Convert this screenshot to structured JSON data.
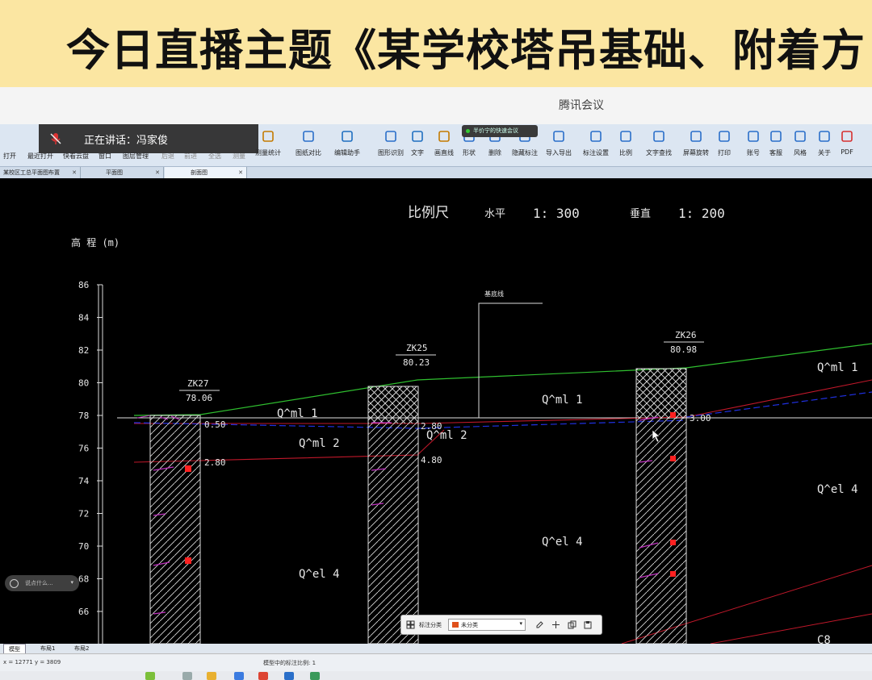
{
  "banner": {
    "title": "今日直播主题《某学校塔吊基础、附着方"
  },
  "meeting": {
    "app_title": "腾讯会议",
    "speaker_label": "正在讲话：冯家俊",
    "share_status": "半价宁的快速会议"
  },
  "toolbar": {
    "buttons": [
      {
        "label": "打开",
        "icon": "open-folder-icon"
      },
      {
        "label": "最近打开",
        "icon": "recent-icon"
      },
      {
        "label": "快看云盘",
        "icon": "cloud-icon"
      },
      {
        "label": "窗口",
        "icon": "window-icon"
      },
      {
        "label": "图层管理",
        "icon": "layers-icon"
      },
      {
        "label": "图纸对比",
        "icon": "compare-icon"
      },
      {
        "label": "测量统计",
        "icon": "measure-stats-icon"
      },
      {
        "label": "图纸对比",
        "icon": "compare2-icon"
      },
      {
        "label": "编辑助手",
        "icon": "edit-helper-icon"
      },
      {
        "label": "图形识别",
        "icon": "recognize-icon"
      },
      {
        "label": "文字",
        "icon": "text-icon"
      },
      {
        "label": "画直线",
        "icon": "line-icon"
      },
      {
        "label": "形状",
        "icon": "shape-icon"
      },
      {
        "label": "删除",
        "icon": "eraser-icon"
      },
      {
        "label": "隐藏标注",
        "icon": "hide-icon"
      },
      {
        "label": "导入导出",
        "icon": "import-export-icon"
      },
      {
        "label": "标注设置",
        "icon": "settings-icon"
      },
      {
        "label": "比例",
        "icon": "scale-icon"
      },
      {
        "label": "文字查找",
        "icon": "search-text-icon"
      },
      {
        "label": "屏幕旋转",
        "icon": "rotate-icon"
      },
      {
        "label": "打印",
        "icon": "print-icon"
      },
      {
        "label": "账号",
        "icon": "user-icon"
      },
      {
        "label": "客服",
        "icon": "headset-icon"
      },
      {
        "label": "风格",
        "icon": "style-icon"
      },
      {
        "label": "关于",
        "icon": "info-icon"
      },
      {
        "label": "PDF",
        "icon": "pdf-icon"
      }
    ],
    "faded_labels": [
      "后退",
      "前进",
      "全选",
      "测量"
    ]
  },
  "doc_tabs": [
    {
      "label": "某校区工总平面图布置"
    },
    {
      "label": "平面图"
    },
    {
      "label": "剖面图"
    }
  ],
  "drawing": {
    "scale_title": "比例尺",
    "scale_h_label": "水平",
    "scale_h_value": "1: 300",
    "scale_v_label": "垂直",
    "scale_v_value": "1: 200",
    "y_axis_label": "高 程 (m)",
    "y_ticks": [
      "86",
      "84",
      "82",
      "80",
      "78",
      "76",
      "74",
      "72",
      "70",
      "68",
      "66"
    ],
    "boreholes": [
      {
        "id": "ZK27",
        "elev": "78.06"
      },
      {
        "id": "ZK25",
        "elev": "80.23"
      },
      {
        "id": "ZK26",
        "elev": "80.98"
      }
    ],
    "depth_labels": [
      "0.50",
      "2.80",
      "2.80",
      "4.80",
      "3.00"
    ],
    "base_line_label": "基底线",
    "layer_labels": [
      "Q^ml 1",
      "Q^ml 2",
      "Q^el 4",
      "Q^ml 1",
      "Q^ml 2",
      "Q^el 4",
      "Q^ml 1",
      "Q^el 4",
      "C8"
    ]
  },
  "mini_toolbar": {
    "label": "标注分类",
    "selected": "未分类",
    "accent": "#e0501a"
  },
  "layout_tabs": [
    "模型",
    "布局1",
    "布局2"
  ],
  "status": {
    "coords": "x = 12771  y = 3809",
    "message": "模型中的标注比例: 1"
  },
  "chat": {
    "placeholder": "说点什么..."
  },
  "colors": {
    "banner_bg": "#fbe6a2",
    "ground_green": "#2fbf2f",
    "strata_red": "#c0182a",
    "water_blue": "#2030e0",
    "marker_magenta": "#c030c0",
    "sample_red": "#ff2020"
  }
}
